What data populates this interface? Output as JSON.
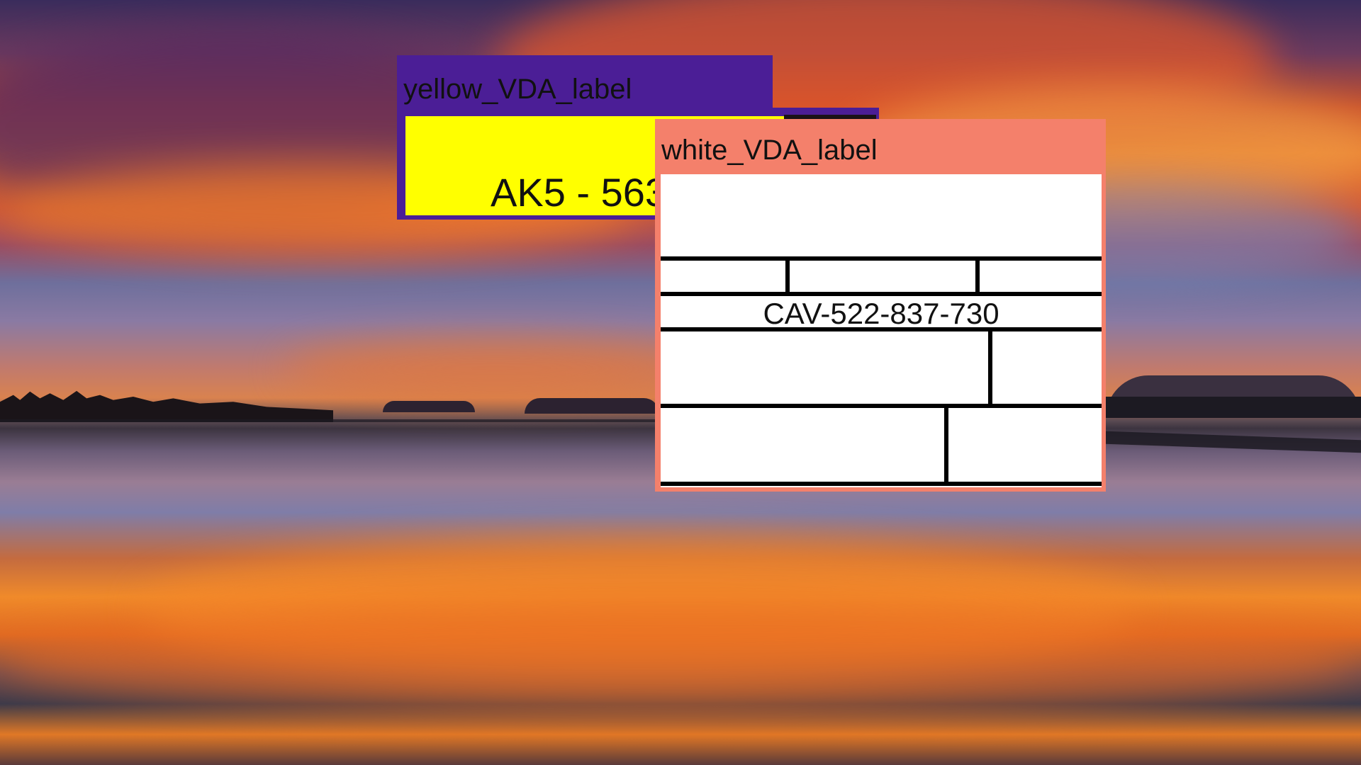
{
  "desktop": {
    "wallpaper": "sunset-lake-photo"
  },
  "yellow_window": {
    "title": "yellow_VDA_label",
    "code": "AK5 - 563",
    "colors": {
      "frame": "#4b1e96",
      "label": "#ffff00"
    }
  },
  "white_window": {
    "title": "white_VDA_label",
    "vda_number": "CAV-522-837-730",
    "colors": {
      "frame": "#f4806b",
      "label": "#ffffff"
    }
  }
}
